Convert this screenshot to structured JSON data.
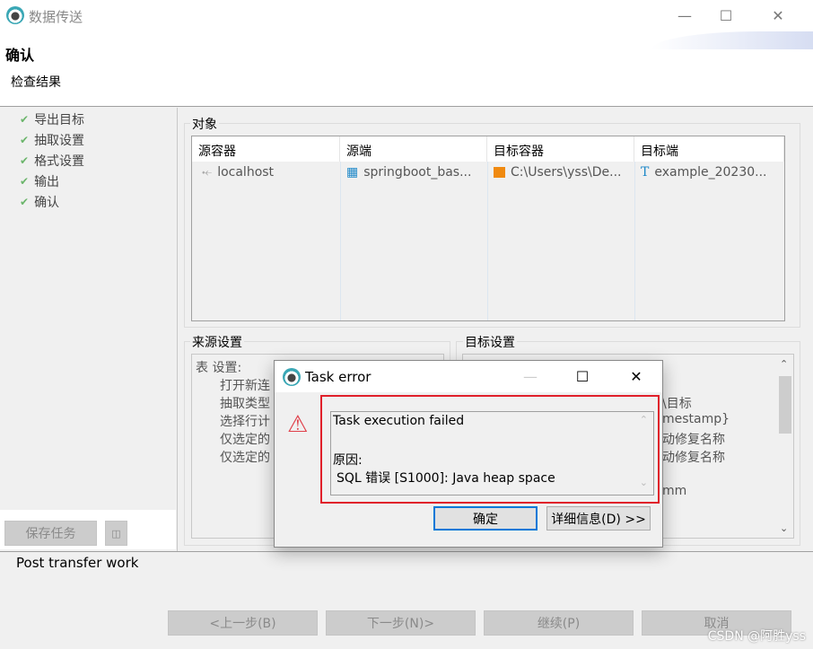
{
  "window": {
    "title": "数据传送",
    "icon": "navicat-icon"
  },
  "header": {
    "title": "确认",
    "subtitle": "检查结果"
  },
  "steps": [
    {
      "label": "导出目标"
    },
    {
      "label": "抽取设置"
    },
    {
      "label": "格式设置"
    },
    {
      "label": "输出"
    },
    {
      "label": "确认"
    }
  ],
  "left": {
    "save_task": "保存任务",
    "save_icon": "save-icon"
  },
  "objects": {
    "label": "对象",
    "columns": [
      "源容器",
      "源端",
      "目标容器",
      "目标端"
    ],
    "row": [
      "localhost",
      "springboot_bas...",
      "C:\\Users\\yss\\De...",
      "example_20230..."
    ]
  },
  "source_settings": {
    "label": "来源设置",
    "heading": "表 设置:",
    "lines": [
      "打开新连",
      "抽取类型",
      "选择行计",
      "仅选定的",
      "仅选定的"
    ]
  },
  "target_settings": {
    "label": "目标设置",
    "lines": [
      "\\目标",
      "mestamp}",
      "动修复名称",
      "动修复名称",
      "mm"
    ]
  },
  "post_transfer": "Post transfer work",
  "nav": {
    "back": "<上一步(B)",
    "next": "下一步(N)>",
    "continue": "继续(P)",
    "cancel": "取消"
  },
  "dialog": {
    "title": "Task error",
    "message": "Task execution failed",
    "reason_label": "原因:",
    "reason": "SQL 错误 [S1000]: Java heap space",
    "ok": "确定",
    "details": "详细信息(D) >>",
    "highlight_color": "#e0202a"
  },
  "watermark": "CSDN @阿胜yss"
}
